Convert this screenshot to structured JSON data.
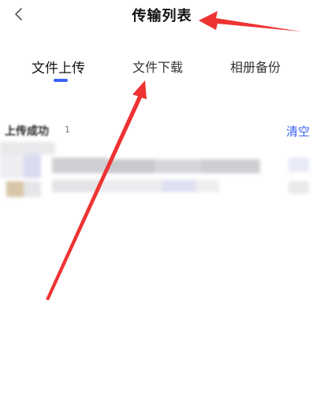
{
  "header": {
    "title": "传输列表",
    "back_icon": "chevron-left-icon"
  },
  "tabs": [
    {
      "label": "文件上传",
      "active": true
    },
    {
      "label": "文件下载",
      "active": false
    },
    {
      "label": "相册备份",
      "active": false
    }
  ],
  "section": {
    "title": "上传成功",
    "count": "1",
    "clear_label": "清空"
  },
  "colors": {
    "accent": "#3c63f5",
    "annotation": "#ee3333"
  }
}
